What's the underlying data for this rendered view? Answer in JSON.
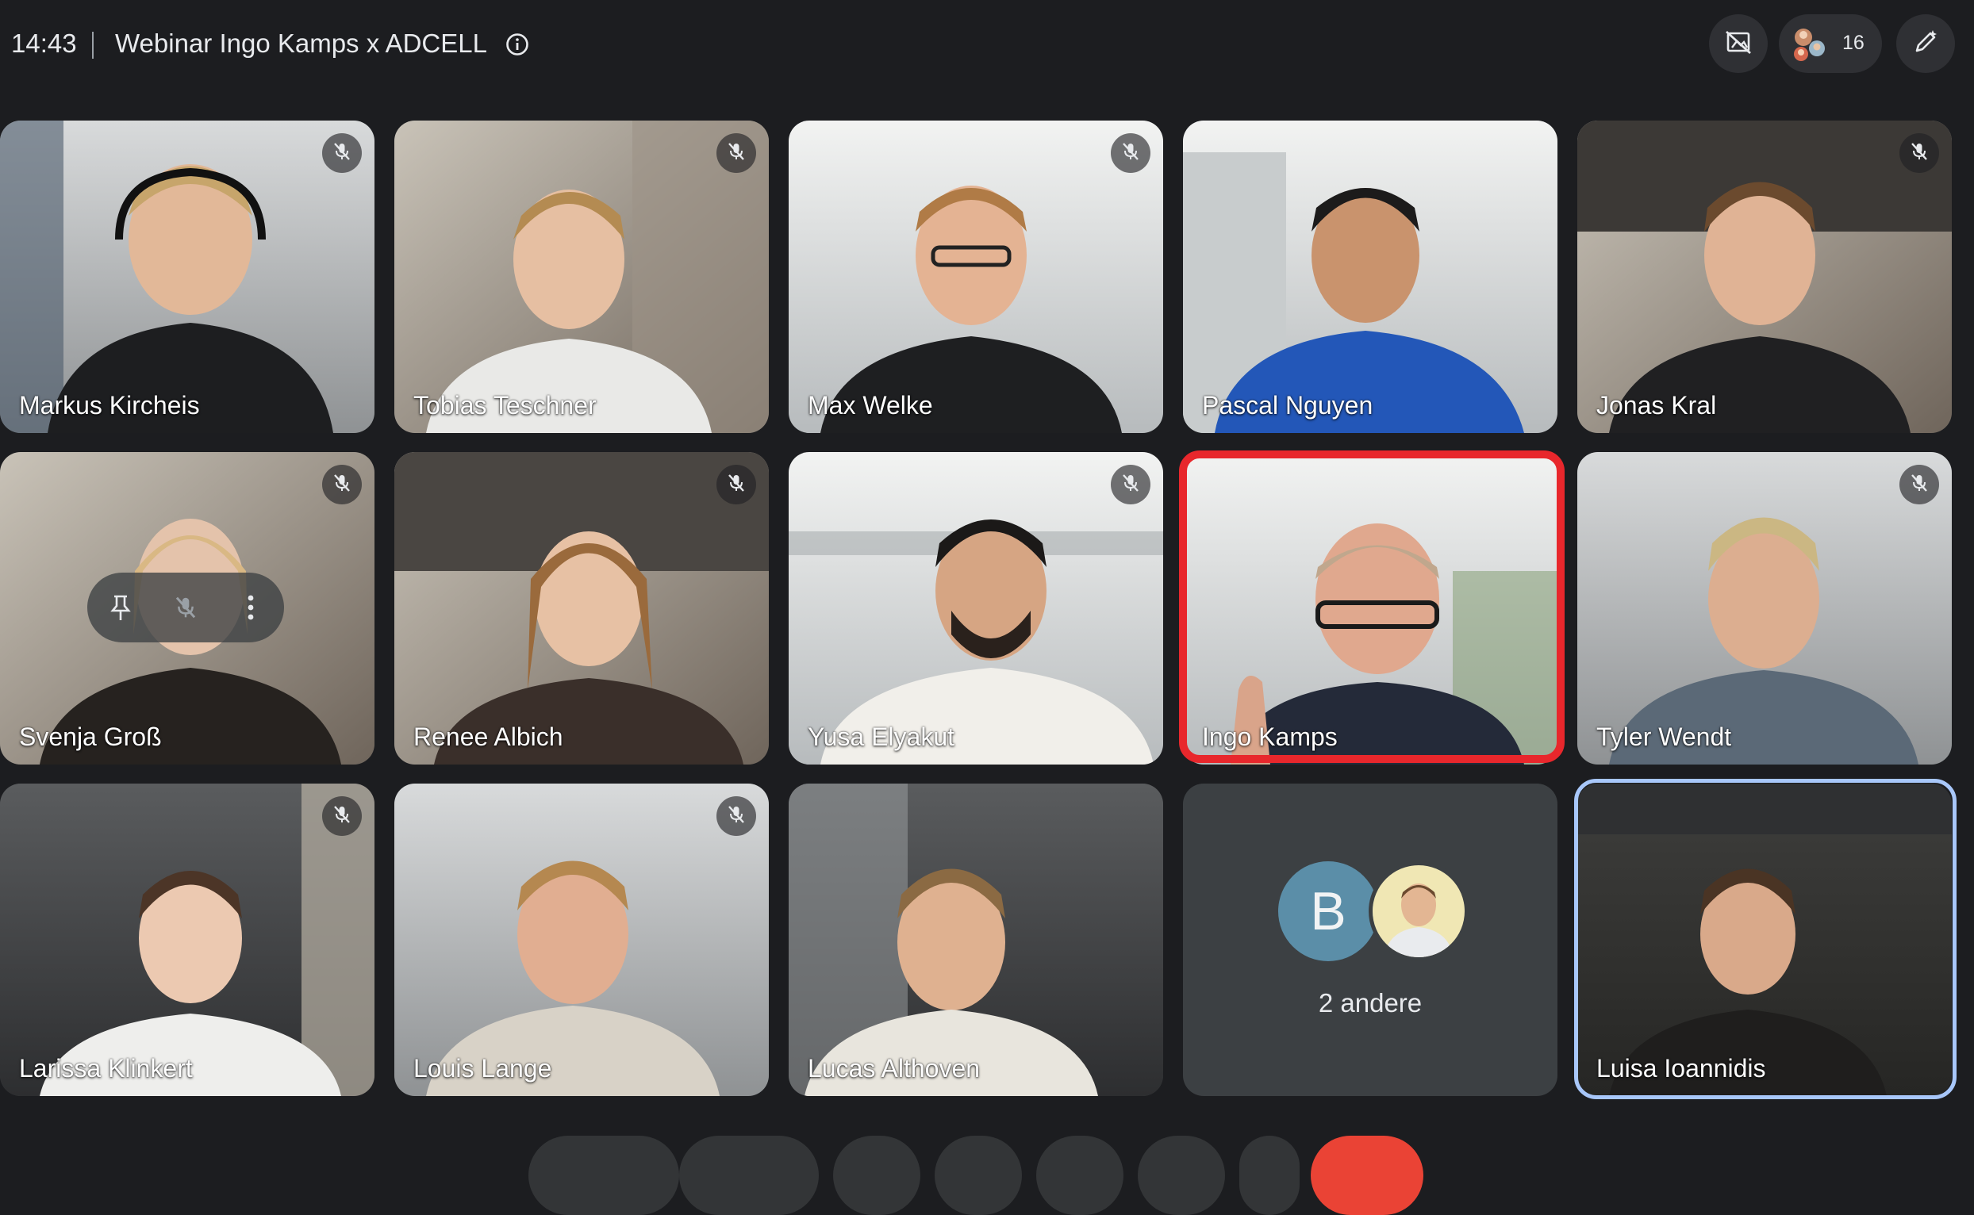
{
  "header": {
    "time": "14:43",
    "meeting_title": "Webinar Ingo Kamps x ADCELL",
    "participant_count": "16"
  },
  "participants": [
    {
      "name": "Markus Kircheis",
      "muted": true
    },
    {
      "name": "Tobias Teschner",
      "muted": true
    },
    {
      "name": "Max Welke",
      "muted": true
    },
    {
      "name": "Pascal Nguyen",
      "muted": false
    },
    {
      "name": "Jonas Kral",
      "muted": true
    },
    {
      "name": "Svenja Groß",
      "muted": true
    },
    {
      "name": "Renee Albich",
      "muted": true
    },
    {
      "name": "Yusa Elyakut",
      "muted": true
    },
    {
      "name": "Ingo Kamps",
      "muted": false,
      "speaking": true
    },
    {
      "name": "Tyler Wendt",
      "muted": true
    },
    {
      "name": "Larissa Klinkert",
      "muted": true
    },
    {
      "name": "Louis Lange",
      "muted": true
    },
    {
      "name": "Lucas Althoven",
      "muted": false
    },
    {
      "name": "Luisa Ioannidis",
      "muted": false,
      "self": true
    }
  ],
  "others_tile": {
    "initial": "B",
    "label": "2 andere"
  },
  "colors": {
    "background": "#1c1d20",
    "tile": "#3c4043",
    "speaking_border": "#e8272c",
    "self_border": "#a8c7fa",
    "leave_button": "#ea4335"
  },
  "icons": [
    "info-icon",
    "no-recording-icon",
    "people-icon",
    "edit-pen-icon",
    "mic-off-icon",
    "pin-icon",
    "more-vert-icon"
  ]
}
